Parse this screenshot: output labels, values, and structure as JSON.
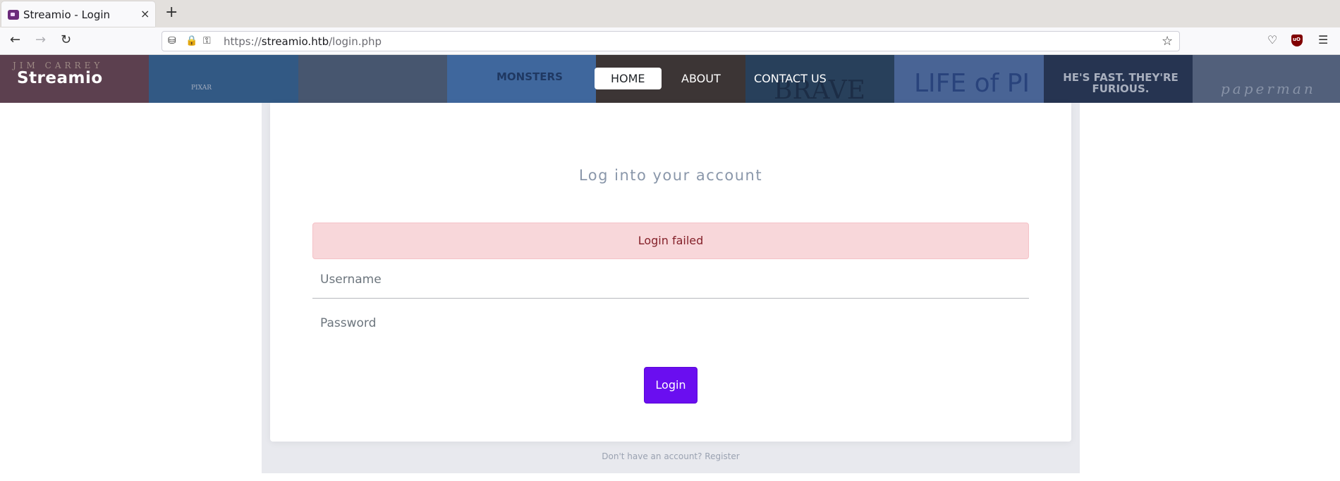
{
  "browser": {
    "tab_title": "Streamio - Login",
    "tab_close": "×",
    "new_tab": "+",
    "url_scheme": "https://",
    "url_host": "streamio.htb",
    "url_path": "/login.php"
  },
  "site": {
    "brand": "Streamio",
    "menu": [
      {
        "label": "HOME",
        "active": true
      },
      {
        "label": "ABOUT",
        "active": false
      },
      {
        "label": "CONTACT US",
        "active": false
      }
    ],
    "posters": [
      {
        "text": "JIM CARREY",
        "color": "#7a4a52"
      },
      {
        "text": "PIXAR",
        "color": "#3b6fa0"
      },
      {
        "text": "",
        "color": "#5a6b80"
      },
      {
        "text": "MONSTERS",
        "color": "#4f83c4"
      },
      {
        "text": "",
        "color": "#4a3a2c"
      },
      {
        "text": "BRAVE",
        "color": "#2d4a63"
      },
      {
        "text": "LIFE of PI",
        "color": "#5d7fb8"
      },
      {
        "text": "HE'S FAST. THEY'RE FURIOUS.",
        "color": "#2a3954"
      },
      {
        "text": "paperman",
        "color": "#6b7a92"
      }
    ]
  },
  "login": {
    "title": "Log into your account",
    "alert": "Login failed",
    "username_placeholder": "Username",
    "password_placeholder": "Password",
    "button": "Login",
    "register_text": "Don't have an account? Register"
  }
}
